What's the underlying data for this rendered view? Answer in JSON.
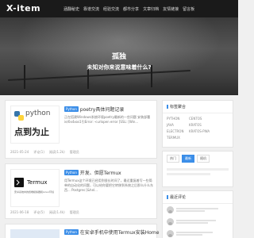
{
  "site": {
    "logo": "X-item"
  },
  "nav": {
    "items": [
      "涵翻秘史",
      "靠谱交流",
      "经验交流",
      "都市分享",
      "文章归档",
      "友情链接",
      "留言板"
    ]
  },
  "hero": {
    "title": "孤独",
    "subtitle": "未知对你来说意味着什么?"
  },
  "posts": [
    {
      "tag": "Python",
      "title": "poetry具体问题记录",
      "excerpt": "正在搭建Windows系统环境poetry最新的一些问题 安装部署ie/0x4xos1引Error: <urlopen error [SSL: [Win...",
      "thumb_text": "点到为止",
      "thumb_logo": "python",
      "date": "2021-05-24",
      "comments": "评论(1)",
      "views": "阅读(1.2k)",
      "author": "管理员"
    },
    {
      "tag": "Python",
      "title": "开发、但愿Termux",
      "excerpt": "用Termux这个环境已经用到很长时间了，最近重复着写一些简单的自动化的问题，可以给你要把它转移到系统之后那么什么东西... Postgres [&hel...",
      "thumb_text": "Termux",
      "thumb_sub": "安卓系统中的终端模拟器和Linux环境",
      "date": "2021-06-18",
      "comments": "评论(5)",
      "views": "阅读(1.4k)",
      "author": "管理员"
    },
    {
      "tag": "Python",
      "title": "在安卓手机中使用Termux安装Home"
    }
  ],
  "sidebar": {
    "tag_heading": "标签聚合",
    "tags": [
      "PYTHON",
      "CENTOS",
      "JAVA",
      "KRATOS",
      "ELECTRON",
      "KRATOS-PWA",
      "TERMUX"
    ],
    "tabs": [
      "热门",
      "最新",
      "随机"
    ],
    "recent_heading": "最近评论"
  }
}
